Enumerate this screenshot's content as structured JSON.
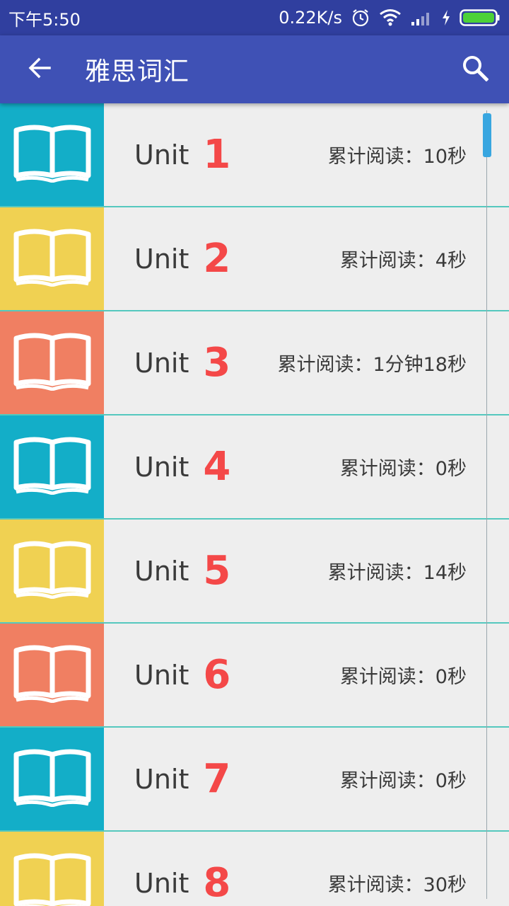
{
  "status_bar": {
    "time": "下午5:50",
    "net_speed": "0.22K/s",
    "icons": [
      "alarm-icon",
      "wifi-icon",
      "signal-icon",
      "charging-icon",
      "battery-icon"
    ]
  },
  "app_bar": {
    "title": "雅思词汇",
    "back_icon": "arrow-left-icon",
    "search_icon": "search-icon"
  },
  "colors": {
    "status_bar": "#303F9F",
    "app_bar": "#3F51B5",
    "unit_number": "#F44848",
    "teal": "#13AEC8",
    "yellow": "#F0D152",
    "salmon": "#F07F62",
    "divider": "#55C8BE",
    "scroll_thumb": "#38A6E0"
  },
  "units": [
    {
      "word": "Unit",
      "number": "1",
      "read_time": "累计阅读：10秒",
      "color": "#13AEC8"
    },
    {
      "word": "Unit",
      "number": "2",
      "read_time": "累计阅读：4秒",
      "color": "#F0D152"
    },
    {
      "word": "Unit",
      "number": "3",
      "read_time": "累计阅读：1分钟18秒",
      "color": "#F07F62"
    },
    {
      "word": "Unit",
      "number": "4",
      "read_time": "累计阅读：0秒",
      "color": "#13AEC8"
    },
    {
      "word": "Unit",
      "number": "5",
      "read_time": "累计阅读：14秒",
      "color": "#F0D152"
    },
    {
      "word": "Unit",
      "number": "6",
      "read_time": "累计阅读：0秒",
      "color": "#F07F62"
    },
    {
      "word": "Unit",
      "number": "7",
      "read_time": "累计阅读：0秒",
      "color": "#13AEC8"
    },
    {
      "word": "Unit",
      "number": "8",
      "read_time": "累计阅读：30秒",
      "color": "#F0D152"
    }
  ]
}
